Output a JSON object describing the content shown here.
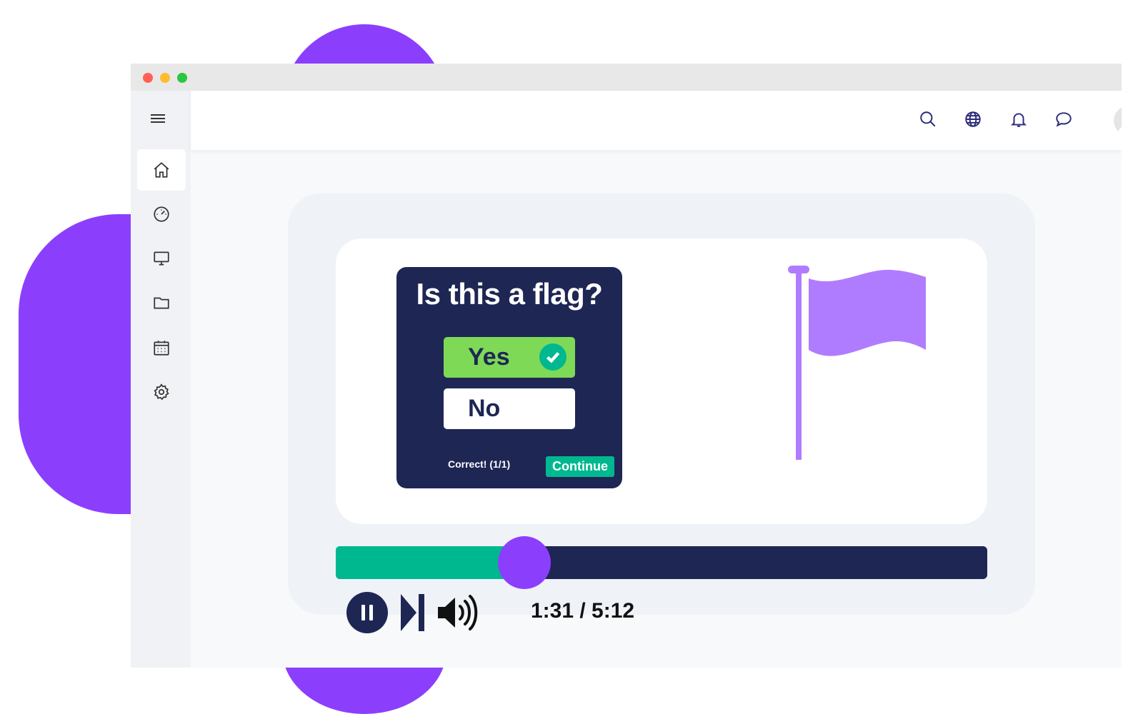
{
  "window": {
    "controls": [
      "close",
      "minimize",
      "maximize"
    ]
  },
  "sidebar": {
    "menu_icon": "hamburger-icon",
    "items": [
      {
        "name": "home",
        "icon": "home-icon",
        "active": true
      },
      {
        "name": "dashboard",
        "icon": "speedometer-icon",
        "active": false
      },
      {
        "name": "display",
        "icon": "monitor-icon",
        "active": false
      },
      {
        "name": "files",
        "icon": "folder-icon",
        "active": false
      },
      {
        "name": "calendar",
        "icon": "calendar-icon",
        "active": false
      },
      {
        "name": "settings",
        "icon": "gear-icon",
        "active": false
      }
    ]
  },
  "topbar": {
    "icons": [
      "search-icon",
      "globe-icon",
      "bell-icon",
      "chat-icon"
    ],
    "profile": {
      "avatar": "avatar",
      "dropdown": "caret-down-icon"
    }
  },
  "quiz": {
    "question": "Is this a flag?",
    "options": [
      {
        "label": "Yes",
        "selected": true,
        "correct": true
      },
      {
        "label": "No",
        "selected": false
      }
    ],
    "status": "Correct! (1/1)",
    "continue_label": "Continue"
  },
  "player": {
    "progress_fraction": 0.29,
    "time": "1:31 / 5:12",
    "controls": [
      "pause-icon",
      "skip-next-icon",
      "volume-icon"
    ]
  },
  "colors": {
    "brand_purple": "#8b3ffd",
    "navy": "#1e2654",
    "teal": "#00b890",
    "green": "#7ed957",
    "flag_purple": "#b07cff"
  }
}
